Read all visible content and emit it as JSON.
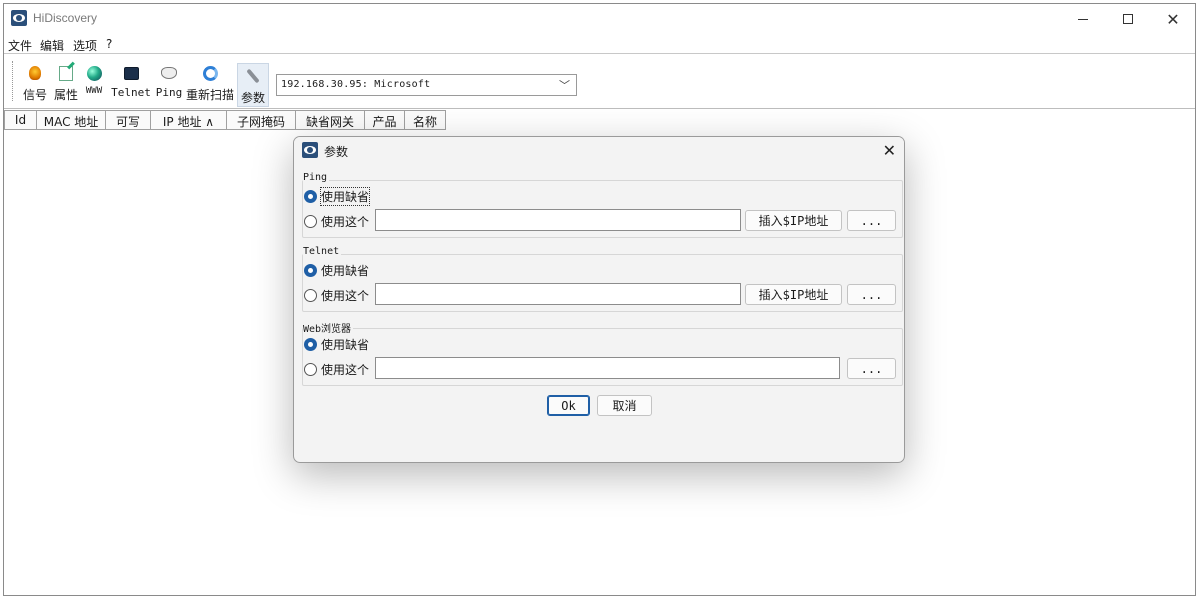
{
  "window": {
    "title": "HiDiscovery"
  },
  "menu": [
    "文件",
    "编辑",
    "选项",
    "?"
  ],
  "toolbar": {
    "buttons": [
      {
        "label": "信号",
        "icon": "signal-icon"
      },
      {
        "label": "属性",
        "icon": "properties-icon"
      },
      {
        "label": "WWW",
        "icon": "globe-icon"
      },
      {
        "label": "Telnet",
        "icon": "telnet-icon"
      },
      {
        "label": "Ping",
        "icon": "ping-icon"
      },
      {
        "label": "重新扫描",
        "icon": "rescan-icon"
      },
      {
        "label": "参数",
        "icon": "wrench-icon"
      }
    ],
    "interface_select": {
      "value": "192.168.30.95: Microsoft"
    }
  },
  "grid": {
    "columns": [
      "Id",
      "MAC 地址",
      "可写",
      "IP 地址 ∧",
      "子网掩码",
      "缺省网关",
      "产品",
      "名称"
    ]
  },
  "dialog": {
    "title": "参数",
    "groups": [
      {
        "label": "Ping",
        "default_label": "使用缺省",
        "custom_label": "使用这个",
        "custom_value": "",
        "insert_label": "插入$IP地址",
        "browse_label": "..."
      },
      {
        "label": "Telnet",
        "default_label": "使用缺省",
        "custom_label": "使用这个",
        "custom_value": "",
        "insert_label": "插入$IP地址",
        "browse_label": "..."
      },
      {
        "label": "Web浏览器",
        "default_label": "使用缺省",
        "custom_label": "使用这个",
        "custom_value": "",
        "browse_label": "..."
      }
    ],
    "ok_label": "Ok",
    "cancel_label": "取消"
  }
}
